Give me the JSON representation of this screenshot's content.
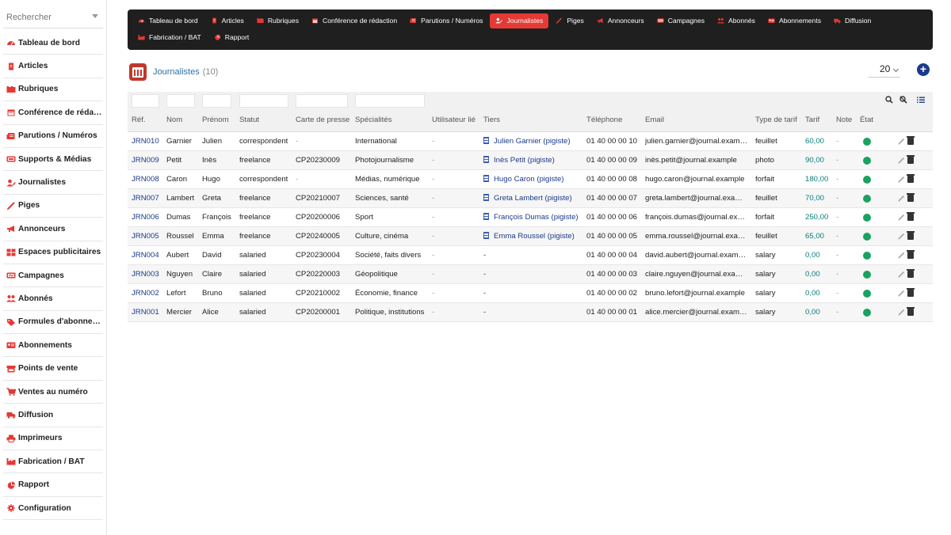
{
  "colors": {
    "accent": "#e53935",
    "nav_bg": "#1f1f1f",
    "link": "#1d3a8a",
    "status_ok": "#1aa260",
    "tarif": "#0a7d7a"
  },
  "search": {
    "placeholder": "Rechercher"
  },
  "sidebar": {
    "items": [
      {
        "label": "Tableau de bord",
        "icon": "dashboard-icon",
        "color": "#e53935"
      },
      {
        "label": "Articles",
        "icon": "document-icon",
        "color": "#e53935"
      },
      {
        "label": "Rubriques",
        "icon": "folders-icon",
        "color": "#e53935"
      },
      {
        "label": "Conférence de rédaction",
        "icon": "calendar-icon",
        "color": "#e53935"
      },
      {
        "label": "Parutions / Numéros",
        "icon": "newspaper-icon",
        "color": "#e53935"
      },
      {
        "label": "Supports & Médias",
        "icon": "media-icon",
        "color": "#e53935"
      },
      {
        "label": "Journalistes",
        "icon": "user-edit-icon",
        "color": "#e53935"
      },
      {
        "label": "Piges",
        "icon": "pen-icon",
        "color": "#e53935"
      },
      {
        "label": "Annonceurs",
        "icon": "megaphone-icon",
        "color": "#e53935"
      },
      {
        "label": "Espaces publicitaires",
        "icon": "grid-icon",
        "color": "#e53935"
      },
      {
        "label": "Campagnes",
        "icon": "campaign-icon",
        "color": "#e53935"
      },
      {
        "label": "Abonnés",
        "icon": "users-icon",
        "color": "#e53935"
      },
      {
        "label": "Formules d'abonnement",
        "icon": "tag-icon",
        "color": "#e53935"
      },
      {
        "label": "Abonnements",
        "icon": "id-card-icon",
        "color": "#e53935"
      },
      {
        "label": "Points de vente",
        "icon": "store-icon",
        "color": "#e53935"
      },
      {
        "label": "Ventes au numéro",
        "icon": "cart-icon",
        "color": "#e53935"
      },
      {
        "label": "Diffusion",
        "icon": "truck-icon",
        "color": "#e53935"
      },
      {
        "label": "Imprimeurs",
        "icon": "printer-icon",
        "color": "#e53935"
      },
      {
        "label": "Fabrication / BAT",
        "icon": "factory-icon",
        "color": "#e53935"
      },
      {
        "label": "Rapport",
        "icon": "pie-chart-icon",
        "color": "#e53935"
      },
      {
        "label": "Configuration",
        "icon": "gear-icon",
        "color": "#e53935"
      }
    ]
  },
  "topnav": {
    "row1": [
      {
        "label": "Tableau de bord",
        "icon": "dashboard-icon",
        "active": false
      },
      {
        "label": "Articles",
        "icon": "document-icon",
        "active": false
      },
      {
        "label": "Rubriques",
        "icon": "folders-icon",
        "active": false
      },
      {
        "label": "Conférence de rédaction",
        "icon": "calendar-icon",
        "active": false
      },
      {
        "label": "Parutions / Numéros",
        "icon": "newspaper-icon",
        "active": false
      },
      {
        "label": "Journalistes",
        "icon": "user-edit-icon",
        "active": true
      },
      {
        "label": "Piges",
        "icon": "pen-icon",
        "active": false
      },
      {
        "label": "Annonceurs",
        "icon": "megaphone-icon",
        "active": false
      },
      {
        "label": "Campagnes",
        "icon": "campaign-icon",
        "active": false
      },
      {
        "label": "Abonnés",
        "icon": "users-icon",
        "active": false
      },
      {
        "label": "Abonnements",
        "icon": "id-card-icon",
        "active": false
      },
      {
        "label": "Diffusion",
        "icon": "truck-icon",
        "active": false
      }
    ],
    "row2": [
      {
        "label": "Fabrication / BAT",
        "icon": "factory-icon",
        "active": false
      },
      {
        "label": "Rapport",
        "icon": "pie-chart-icon",
        "active": false
      }
    ]
  },
  "page": {
    "title": "Journalistes",
    "count": "(10)",
    "page_size": "20",
    "add_label": "+"
  },
  "table": {
    "columns": [
      "Réf.",
      "Nom",
      "Prénom",
      "Statut",
      "Carte de presse",
      "Spécialités",
      "Utilisateur lié",
      "Tiers",
      "Téléphone",
      "Email",
      "Type de tarif",
      "Tarif",
      "Note",
      "État"
    ],
    "rows": [
      {
        "ref": "JRN010",
        "nom": "Garnier",
        "prenom": "Julien",
        "statut": "correspondent",
        "carte": "-",
        "specialites": "International",
        "utilisateur": "-",
        "tiers": "Julien Garnier (pigiste)",
        "telephone": "01 40 00 00 10",
        "email": "julien.garnier@journal.example",
        "type_tarif": "feuillet",
        "tarif": "60,00",
        "note": "-",
        "etat": "ok"
      },
      {
        "ref": "JRN009",
        "nom": "Petit",
        "prenom": "Inès",
        "statut": "freelance",
        "carte": "CP20230009",
        "specialites": "Photojournalisme",
        "utilisateur": "-",
        "tiers": "Inès Petit (pigiste)",
        "telephone": "01 40 00 00 09",
        "email": "inès.petit@journal.example",
        "type_tarif": "photo",
        "tarif": "90,00",
        "note": "-",
        "etat": "ok"
      },
      {
        "ref": "JRN008",
        "nom": "Caron",
        "prenom": "Hugo",
        "statut": "correspondent",
        "carte": "-",
        "specialites": "Médias, numérique",
        "utilisateur": "-",
        "tiers": "Hugo Caron (pigiste)",
        "telephone": "01 40 00 00 08",
        "email": "hugo.caron@journal.example",
        "type_tarif": "forfait",
        "tarif": "180,00",
        "note": "-",
        "etat": "ok"
      },
      {
        "ref": "JRN007",
        "nom": "Lambert",
        "prenom": "Greta",
        "statut": "freelance",
        "carte": "CP20210007",
        "specialites": "Sciences, santé",
        "utilisateur": "-",
        "tiers": "Greta Lambert (pigiste)",
        "telephone": "01 40 00 00 07",
        "email": "greta.lambert@journal.example",
        "type_tarif": "feuillet",
        "tarif": "70,00",
        "note": "-",
        "etat": "ok"
      },
      {
        "ref": "JRN006",
        "nom": "Dumas",
        "prenom": "François",
        "statut": "freelance",
        "carte": "CP20200006",
        "specialites": "Sport",
        "utilisateur": "-",
        "tiers": "François Dumas (pigiste)",
        "telephone": "01 40 00 00 06",
        "email": "françois.dumas@journal.example",
        "type_tarif": "forfait",
        "tarif": "250,00",
        "note": "-",
        "etat": "ok"
      },
      {
        "ref": "JRN005",
        "nom": "Roussel",
        "prenom": "Emma",
        "statut": "freelance",
        "carte": "CP20240005",
        "specialites": "Culture, cinéma",
        "utilisateur": "-",
        "tiers": "Emma Roussel (pigiste)",
        "telephone": "01 40 00 00 05",
        "email": "emma.roussel@journal.example",
        "type_tarif": "feuillet",
        "tarif": "65,00",
        "note": "-",
        "etat": "ok"
      },
      {
        "ref": "JRN004",
        "nom": "Aubert",
        "prenom": "David",
        "statut": "salaried",
        "carte": "CP20230004",
        "specialites": "Société, faits divers",
        "utilisateur": "-",
        "tiers": "-",
        "telephone": "01 40 00 00 04",
        "email": "david.aubert@journal.example",
        "type_tarif": "salary",
        "tarif": "0,00",
        "note": "-",
        "etat": "ok"
      },
      {
        "ref": "JRN003",
        "nom": "Nguyen",
        "prenom": "Claire",
        "statut": "salaried",
        "carte": "CP20220003",
        "specialites": "Géopolitique",
        "utilisateur": "-",
        "tiers": "-",
        "telephone": "01 40 00 00 03",
        "email": "claire.nguyen@journal.example",
        "type_tarif": "salary",
        "tarif": "0,00",
        "note": "-",
        "etat": "ok"
      },
      {
        "ref": "JRN002",
        "nom": "Lefort",
        "prenom": "Bruno",
        "statut": "salaried",
        "carte": "CP20210002",
        "specialites": "Économie, finance",
        "utilisateur": "-",
        "tiers": "-",
        "telephone": "01 40 00 00 02",
        "email": "bruno.lefort@journal.example",
        "type_tarif": "salary",
        "tarif": "0,00",
        "note": "-",
        "etat": "ok"
      },
      {
        "ref": "JRN001",
        "nom": "Mercier",
        "prenom": "Alice",
        "statut": "salaried",
        "carte": "CP20200001",
        "specialites": "Politique, institutions",
        "utilisateur": "-",
        "tiers": "-",
        "telephone": "01 40 00 00 01",
        "email": "alice.mercier@journal.example",
        "type_tarif": "salary",
        "tarif": "0,00",
        "note": "-",
        "etat": "ok"
      }
    ]
  }
}
